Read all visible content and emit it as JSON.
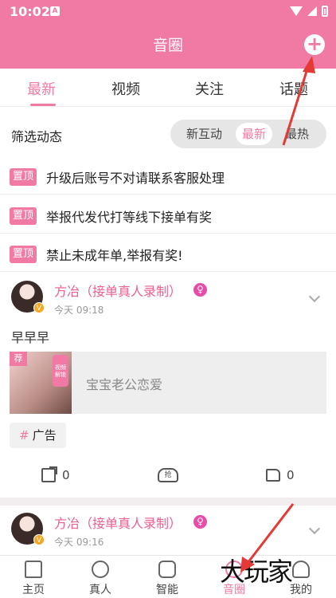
{
  "status_bar": {
    "time": "10:02",
    "notif_letter": "A"
  },
  "header": {
    "title": "音圈",
    "add_symbol": "+"
  },
  "tabs": [
    {
      "label": "最新",
      "active": true
    },
    {
      "label": "视频",
      "active": false
    },
    {
      "label": "关注",
      "active": false
    },
    {
      "label": "话题",
      "active": false
    }
  ],
  "filter": {
    "label": "筛选动态",
    "options": [
      "新互动",
      "最新",
      "最热"
    ],
    "selected": "最新"
  },
  "pinned": [
    {
      "badge": "置顶",
      "text": "升级后账号不对请联系客服处理"
    },
    {
      "badge": "置顶",
      "text": "举报代发代打等线下接单有奖"
    },
    {
      "badge": "置顶",
      "text": "禁止未成年单,举报有奖!"
    }
  ],
  "posts": [
    {
      "name": "方冶（接单真人录制）",
      "time": "今天 09:18",
      "text": "早早早",
      "media_tag": "荐",
      "media_lock": "视频解锁",
      "media_caption": "宝宝老公恋爱",
      "hashtag": "广告",
      "share_count": "0",
      "like_count": "0",
      "grab_label": "抢"
    },
    {
      "name": "方冶（接单真人录制）",
      "time": "今天 09:16"
    }
  ],
  "bottom_nav": [
    {
      "label": "主页",
      "icon": "home-icon"
    },
    {
      "label": "真人",
      "icon": "person-icon"
    },
    {
      "label": "智能",
      "icon": "robot-icon"
    },
    {
      "label": "音圈",
      "icon": "circle-icon",
      "active": true
    },
    {
      "label": "我的",
      "icon": "user-icon"
    }
  ],
  "watermark": "大玩家",
  "colors": {
    "accent": "#f07aa4",
    "gender": "#e94ca8",
    "arrow": "#e53935"
  }
}
